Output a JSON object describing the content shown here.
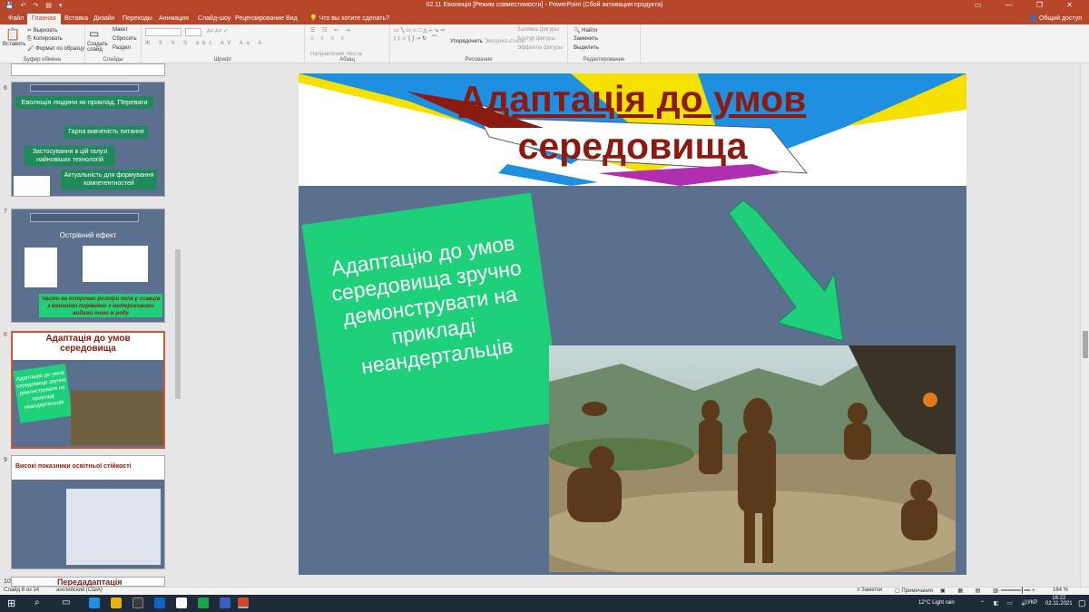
{
  "titlebar": {
    "title": "02.11 Еволюція [Режим совместимости] - PowerPoint (Сбой активации продукта)",
    "quick_access": "💾 ↶ ↷ ▤ ▾"
  },
  "tabs": [
    "Файл",
    "Главная",
    "Вставка",
    "Дизайн",
    "Переходы",
    "Анимация",
    "Слайд-шоу",
    "Рецензирование",
    "Вид"
  ],
  "tell_me": "Что вы хотите сделать?",
  "share": "Общий доступ",
  "ribbon": {
    "clipboard": {
      "label": "Буфер обмена",
      "paste": "Вставить",
      "cut": "Вырезать",
      "copy": "Копировать",
      "format": "Формат по образцу"
    },
    "slides": {
      "label": "Слайды",
      "new_slide": "Создать слайд",
      "layout": "Макет",
      "reset": "Сбросить",
      "section": "Раздел"
    },
    "font": {
      "label": "Шрифт"
    },
    "paragraph": {
      "label": "Абзац",
      "dir": "Направление текста",
      "align": "Выровнять текст",
      "smartart": "Преобразовать в SmartArt"
    },
    "drawing": {
      "label": "Рисование",
      "arrange": "Упорядочить",
      "styles": "Экспресс-стили",
      "fill": "Заливка фигуры",
      "outline": "Контур фигуры",
      "effects": "Эффекты фигуры"
    },
    "editing": {
      "label": "Редактирование",
      "find": "Найти",
      "replace": "Заменить",
      "select": "Выделить"
    }
  },
  "thumbnails": [
    {
      "num": "6",
      "title": "Еволюція людини як приклад. Переваги",
      "items": [
        "Гарна вивченість питання",
        "Застосування в цій галузі найновіших технологій",
        "Актуальність для формування компетентностей"
      ]
    },
    {
      "num": "7",
      "title": "Острівний ефект",
      "caption": "Часто на островах розміри тіла у ссавців з меншими порівняно з материковими видами того ж роду"
    },
    {
      "num": "8",
      "title": "Адаптація до умов середовища",
      "text": "Адаптацію до умов середовища зручно демонструвати на прикладі неандертальців"
    },
    {
      "num": "9",
      "title": "Високі показники освітньої стійкості"
    },
    {
      "num": "10",
      "title": "Передадаптація"
    }
  ],
  "slide": {
    "title_line1": "Адаптація до умов",
    "title_line2": "середовища",
    "body": [
      "Адаптацію до умов",
      "середовища зручно",
      "демонструвати на",
      "прикладі",
      "неандертальців"
    ]
  },
  "status": {
    "slide": "Слайд 8 из 14",
    "lang": "английский (США)",
    "notes": "Заметки",
    "comments": "Примечания",
    "zoom": "164 %"
  },
  "taskbar": {
    "weather": "12°C  Light rain",
    "lang": "УКР",
    "time": "16:22",
    "date": "02.11.2021"
  },
  "colors": {
    "accent": "#b7472a",
    "slide_bg": "#5b6f8e",
    "green": "#1fd07a",
    "title": "#8b1a10"
  }
}
